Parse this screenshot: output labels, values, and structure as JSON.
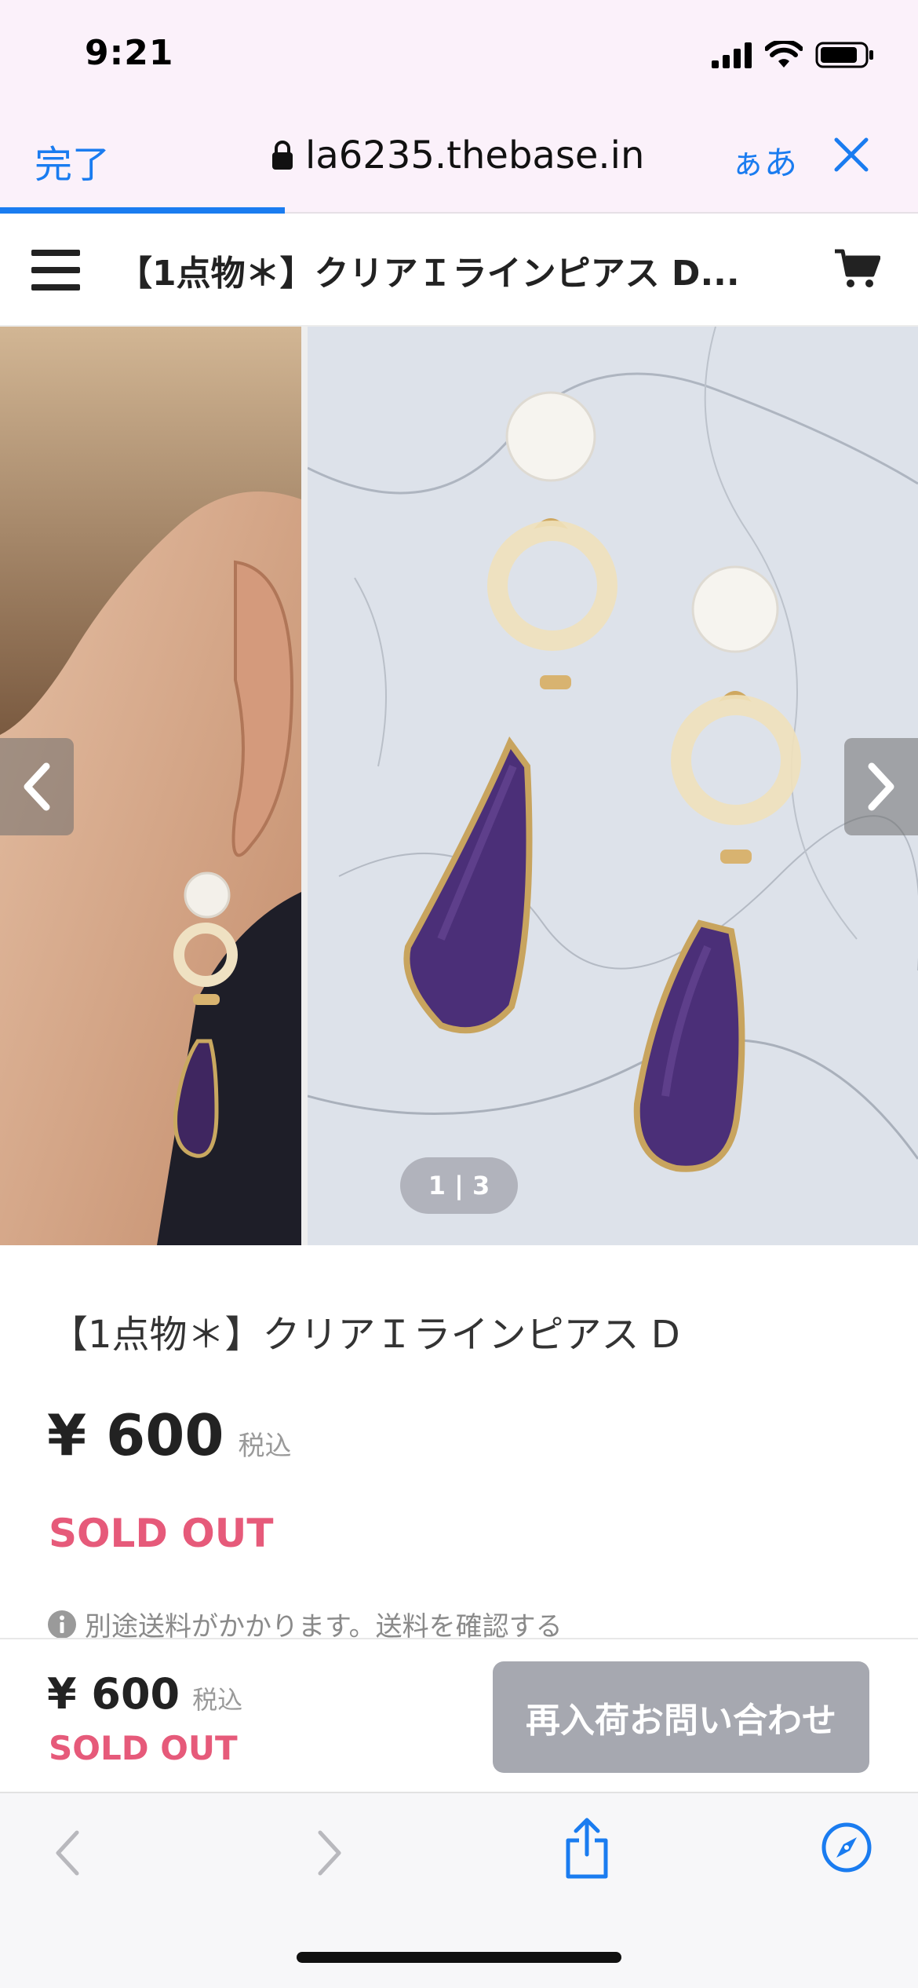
{
  "status_bar": {
    "time": "9:21"
  },
  "browser": {
    "done_label": "完了",
    "url": "la6235.thebase.in",
    "text_size_label": "ぁあ",
    "page_load_progress": 0.31
  },
  "site_header": {
    "title": "【1点物＊】クリアＩラインピアス D..."
  },
  "gallery": {
    "page_indicator": "1 | 3"
  },
  "product": {
    "title": "【1点物＊】クリアＩラインピアス D",
    "price": "¥ 600",
    "tax_label": "税込",
    "status": "SOLD OUT",
    "shipping_note": "別途送料がかかります。送料を確認する"
  },
  "sticky_bar": {
    "price": "¥ 600",
    "tax_label": "税込",
    "status": "SOLD OUT",
    "restock_button": "再入荷お問い合わせ"
  },
  "colors": {
    "accent": "#1a7cf0",
    "sold_out": "#e65a7a",
    "disabled_button": "#a6a8b0",
    "browser_bar": "#fbf1fa"
  },
  "icons": [
    "signal-icon",
    "wifi-icon",
    "battery-icon",
    "lock-icon",
    "close-icon",
    "hamburger-menu-icon",
    "cart-icon",
    "chevron-left-icon",
    "chevron-right-icon",
    "info-icon",
    "back-icon",
    "forward-icon",
    "share-icon",
    "compass-icon"
  ]
}
